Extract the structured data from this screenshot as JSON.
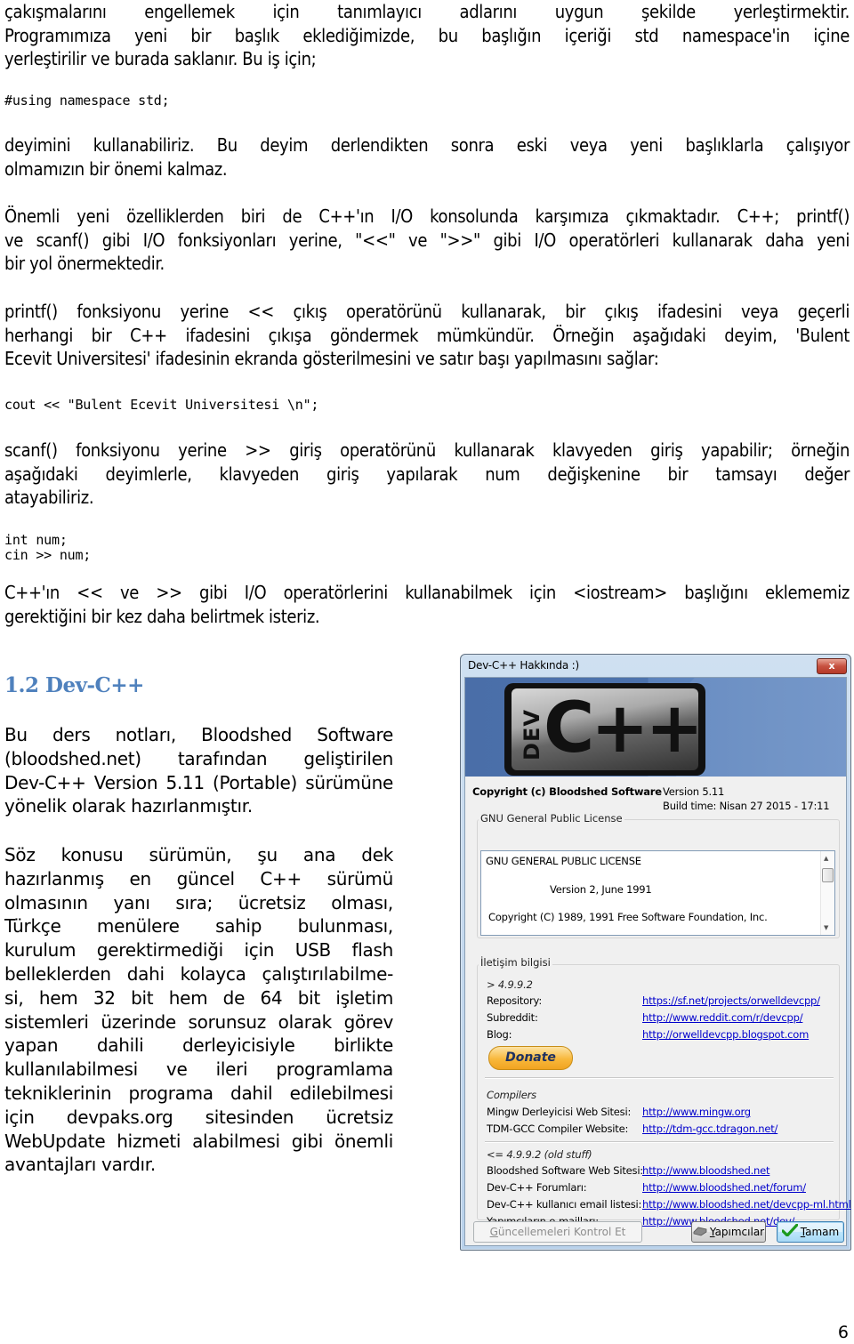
{
  "document": {
    "para1_lines": [
      "çakışmalarını engellemek için tanımlayıcı adlarını uygun şekilde yerleştirmektir.",
      "Programımıza yeni bir başlık eklediğimizde, bu başlığın içeriği std namespace'in içine",
      "yerleştirilir ve burada saklanır. Bu iş için;"
    ],
    "code1": "#using namespace std;",
    "para2_lines": [
      "deyimini kullanabiliriz. Bu deyim derlendikten sonra eski veya yeni başlıklarla çalışıyor",
      "olmamızın bir önemi kalmaz."
    ],
    "para3_lines": [
      "Önemli yeni özelliklerden biri de C++'ın I/O konsolunda karşımıza çıkmaktadır. C++; printf()",
      "ve scanf() gibi I/O fonksiyonları yerine, \"<<\" ve \">>\" gibi I/O operatörleri kullanarak daha yeni",
      "bir yol önermektedir."
    ],
    "para4_lines": [
      "printf() fonksiyonu yerine << çıkış operatörünü kullanarak, bir çıkış ifadesini veya geçerli",
      "herhangi bir C++ ifadesini çıkışa göndermek mümkündür. Örneğin aşağıdaki deyim, 'Bulent",
      "Ecevit Universitesi' ifadesinin ekranda gösterilmesini ve satır başı yapılmasını sağlar:"
    ],
    "code2": "cout << \"Bulent Ecevit Universitesi \\n\";",
    "para5_lines": [
      "scanf() fonksiyonu yerine >> giriş operatörünü kullanarak klavyeden giriş yapabilir; örneğin",
      "aşağıdaki deyimlerle, klavyeden giriş yapılarak num değişkenine bir tamsayı değer",
      "atayabiliriz."
    ],
    "code3": "int num;\ncin >> num;",
    "para6_lines": [
      "C++'ın << ve >> gibi I/O operatörlerini kullanabilmek için <iostream> başlığını eklememiz",
      "gerektiğini bir kez daha belirtmek isteriz."
    ],
    "section_heading": "1.2 Dev-C++",
    "para7_lines": [
      "Bu ders notları, Bloodshed Software",
      "(bloodshed.net) tarafından geliştirilen",
      "Dev-C++ Version 5.11 (Portable) sürümüne",
      "yönelik olarak hazırlanmıştır."
    ],
    "para8_lines": [
      "Söz konusu sürümün, şu ana dek",
      "hazırlanmış en güncel C++ sürümü",
      "olmasının yanı sıra; ücretsiz olması,",
      "Türkçe menülere sahip bulunması,",
      "kurulum gerektirmediği için USB flash",
      "belleklerden dahi kolayca çalıştırılabilme-",
      "si, hem 32 bit hem de 64 bit işletim",
      "sistemleri üzerinde sorunsuz olarak görev",
      "yapan dahili derleyicisiyle birlikte",
      "kullanılabilmesi ve ileri programlama",
      "tekniklerinin programa dahil edilebilmesi",
      "için devpaks.org sitesinden ücretsiz",
      "WebUpdate hizmeti alabilmesi gibi önemli",
      "avantajları vardır."
    ],
    "page_number": "6"
  },
  "dialog": {
    "title": "Dev-C++ Hakkında :)",
    "close_label": "x",
    "logo": {
      "dev": "DEV",
      "cpp": "C++"
    },
    "copyright": "Copyright (c) Bloodshed Software",
    "version": "Version 5.11",
    "build_time": "Build time: Nisan 27 2015 - 17:11",
    "license_group": "GNU General Public License",
    "license_text": {
      "line1": "GNU GENERAL PUBLIC LICENSE",
      "line2": "Version 2, June 1991",
      "line3": "Copyright (C) 1989, 1991 Free Software Foundation, Inc."
    },
    "contact_group": "İletişim bilgisi",
    "current_header": "> 4.9.9.2",
    "current_links": [
      {
        "label": "Repository:",
        "url": "https://sf.net/projects/orwelldevcpp/"
      },
      {
        "label": "Subreddit:",
        "url": "http://www.reddit.com/r/devcpp/"
      },
      {
        "label": "Blog:",
        "url": "http://orwelldevcpp.blogspot.com"
      }
    ],
    "donate_label": "Donate",
    "compilers_header": "Compilers",
    "compiler_links": [
      {
        "label": "Mingw Derleyicisi Web Sitesi:",
        "url": "http://www.mingw.org"
      },
      {
        "label": "TDM-GCC Compiler Website:",
        "url": "http://tdm-gcc.tdragon.net/"
      }
    ],
    "old_header": "<= 4.9.9.2 (old stuff)",
    "old_links": [
      {
        "label": "Bloodshed Software Web Sitesi:",
        "url": "http://www.bloodshed.net"
      },
      {
        "label": "Dev-C++ Forumları:",
        "url": "http://www.bloodshed.net/forum/"
      },
      {
        "label": "Dev-C++ kullanıcı email listesi:",
        "url": "http://www.bloodshed.net/devcpp-ml.html"
      },
      {
        "label": "Yapımcıların e-mailları:",
        "url": "http://www.bloodshed.net/dev/"
      }
    ],
    "buttons": {
      "check_updates": {
        "accel": "G",
        "rest": "üncellemeleri Kontrol Et"
      },
      "authors": {
        "accel": "Y",
        "rest": "apımcılar"
      },
      "ok": {
        "accel": "T",
        "rest": "amam"
      }
    }
  }
}
